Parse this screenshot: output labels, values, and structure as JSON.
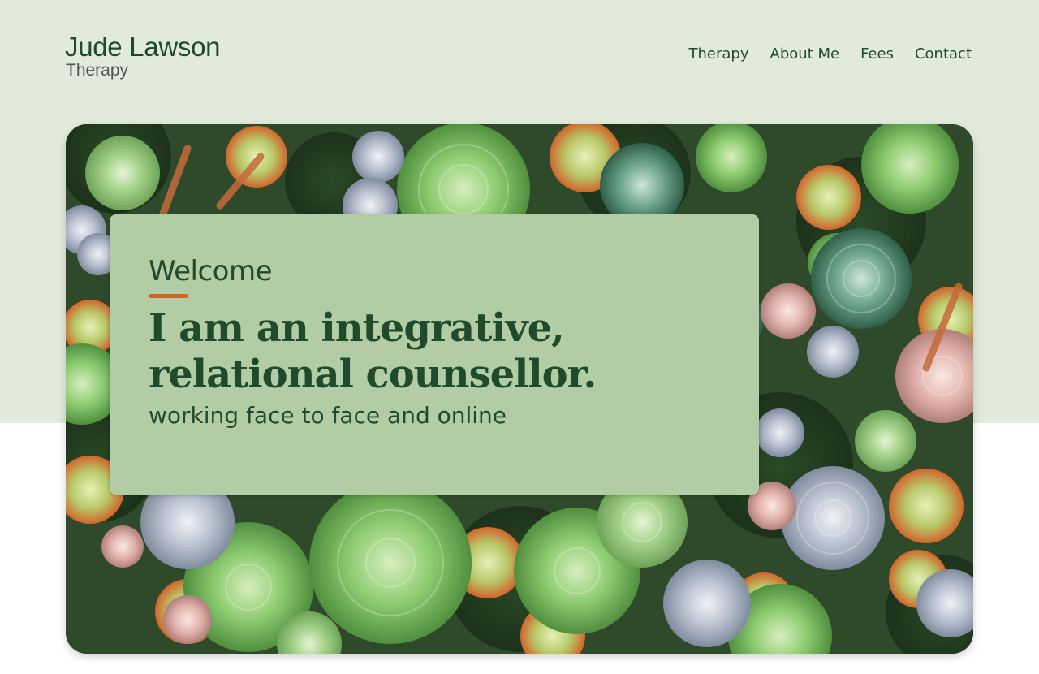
{
  "header": {
    "logo_name": "Jude Lawson",
    "logo_subtitle": "Therapy"
  },
  "nav": {
    "items": [
      "Therapy",
      "About Me",
      "Fees",
      "Contact"
    ]
  },
  "hero": {
    "welcome": "Welcome",
    "headline_line1": "I am an integrative,",
    "headline_line2": "relational counsellor.",
    "subtitle": "working face to face and online"
  },
  "colors": {
    "band": "#e2eadc",
    "brand_green": "#1f4b2c",
    "card": "#b2cda6",
    "accent": "#d2652c"
  }
}
